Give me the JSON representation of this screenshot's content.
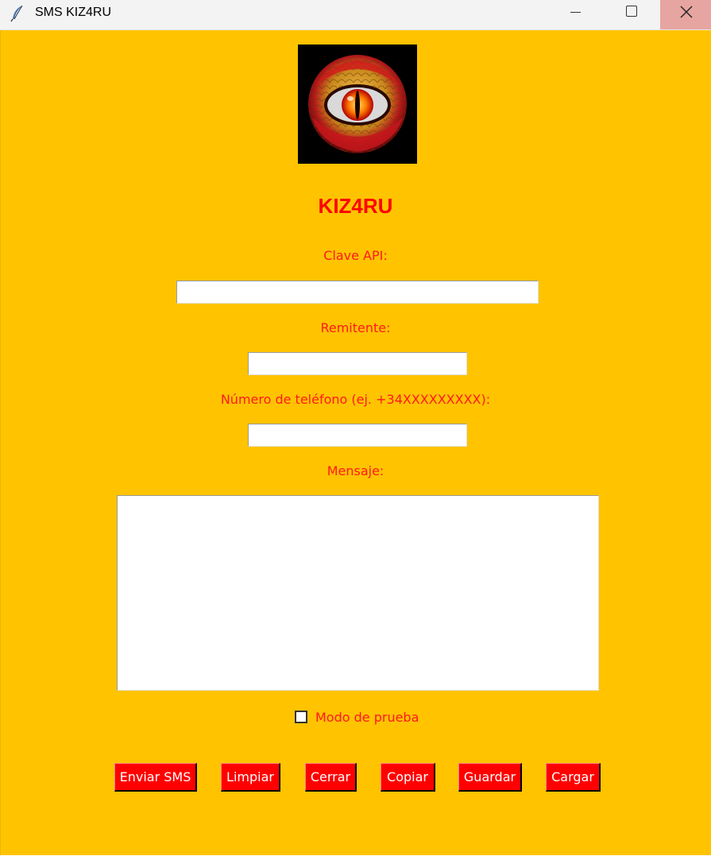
{
  "window": {
    "title": "SMS KIZ4RU"
  },
  "app": {
    "heading": "KIZ4RU",
    "logo_icon": "dragon-eye-logo"
  },
  "form": {
    "api_key_label": "Clave API:",
    "api_key_value": "",
    "sender_label": "Remitente:",
    "sender_value": "",
    "phone_label": "Número de teléfono (ej. +34XXXXXXXXX):",
    "phone_value": "",
    "message_label": "Mensaje:",
    "message_value": "",
    "test_mode_label": "Modo de prueba",
    "test_mode_checked": false
  },
  "buttons": {
    "send": "Enviar SMS",
    "clear": "Limpiar",
    "close": "Cerrar",
    "copy": "Copiar",
    "save": "Guardar",
    "load": "Cargar"
  },
  "colors": {
    "background": "#ffc300",
    "accent": "#ff0000",
    "button_text": "#ffffff"
  }
}
